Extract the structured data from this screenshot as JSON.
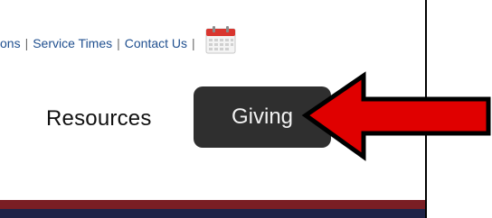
{
  "top_links": {
    "item_partial": "ons",
    "service_times": "Service Times",
    "contact_us": "Contact Us",
    "separator": "|",
    "calendar_icon": "calendar-icon"
  },
  "nav": {
    "resources_label": "Resources",
    "giving_label": "Giving"
  },
  "annotation": {
    "arrow_icon": "red-arrow-icon",
    "arrow_color": "#e00000"
  },
  "colors": {
    "link": "#1f4f8f",
    "giving_button_bg": "#2f2f2f",
    "stripe_red": "#7a1e24",
    "stripe_navy": "#1f2347"
  }
}
